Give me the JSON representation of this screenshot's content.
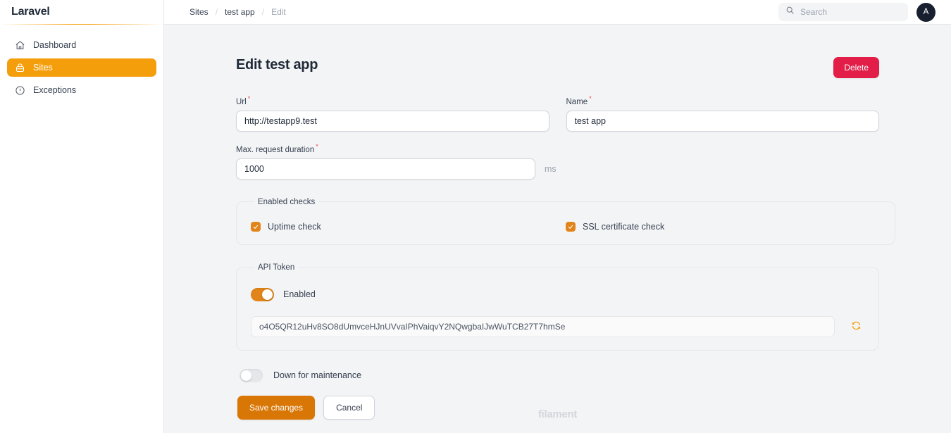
{
  "sidebar": {
    "brand": "Laravel",
    "items": [
      {
        "label": "Dashboard",
        "icon": "home-icon",
        "active": false
      },
      {
        "label": "Sites",
        "icon": "server-icon",
        "active": true
      },
      {
        "label": "Exceptions",
        "icon": "exclamation-circle-icon",
        "active": false
      }
    ]
  },
  "topbar": {
    "breadcrumb": [
      {
        "label": "Sites",
        "current": false
      },
      {
        "label": "test app",
        "current": false
      },
      {
        "label": "Edit",
        "current": true
      }
    ],
    "separator": "/",
    "search": {
      "placeholder": "Search",
      "value": "",
      "icon": "search-icon"
    },
    "avatar": {
      "initial": "A"
    }
  },
  "page": {
    "title": "Edit test app",
    "delete_label": "Delete",
    "fields": {
      "url": {
        "label": "Url",
        "required_marker": "*",
        "value": "http://testapp9.test"
      },
      "name": {
        "label": "Name",
        "required_marker": "*",
        "value": "test app"
      },
      "max_request_duration": {
        "label": "Max. request duration",
        "required_marker": "*",
        "value": "1000",
        "suffix": "ms"
      }
    },
    "enabled_checks": {
      "legend": "Enabled checks",
      "items": [
        {
          "label": "Uptime check",
          "checked": true
        },
        {
          "label": "SSL certificate check",
          "checked": true
        }
      ]
    },
    "api_token": {
      "legend": "API Token",
      "toggle_label": "Enabled",
      "toggle_on": true,
      "token": "o4O5QR12uHv8SO8dUmvceHJnUVvaIPhVaiqvY2NQwgbaIJwWuTCB27T7hmSe",
      "refresh_icon": "refresh-icon"
    },
    "maintenance": {
      "label": "Down for maintenance",
      "toggle_on": false
    },
    "actions": {
      "save_label": "Save changes",
      "cancel_label": "Cancel"
    },
    "footer_brand": "filament"
  },
  "colors": {
    "accent": "#f59e0b",
    "accent_dark": "#d97706",
    "danger": "#e11d48",
    "page_bg": "#f3f4f6",
    "avatar_bg": "#18202f"
  }
}
